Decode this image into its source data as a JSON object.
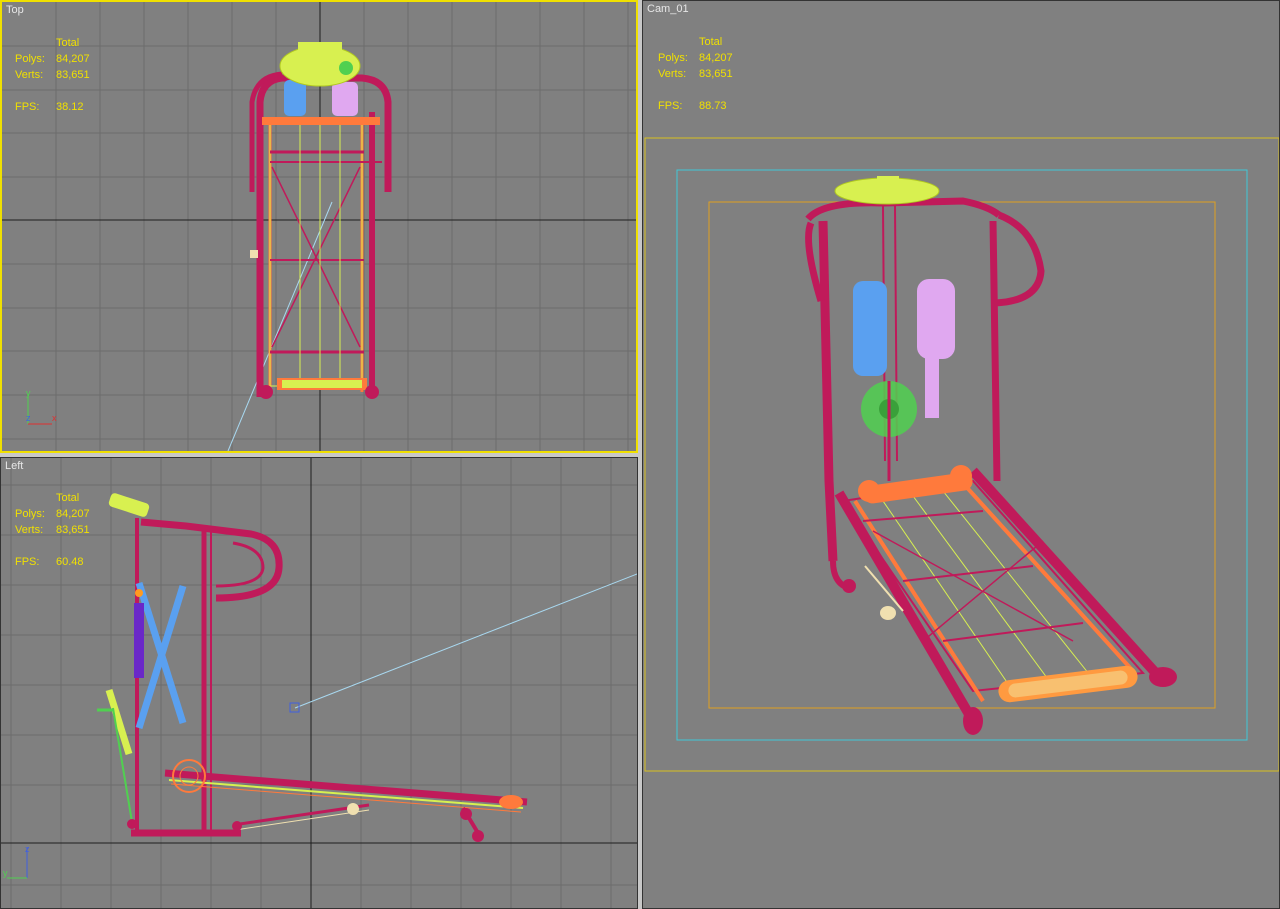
{
  "viewports": {
    "top": {
      "label": "Top",
      "stats": {
        "header": "Total",
        "polys_label": "Polys:",
        "polys": "84,207",
        "verts_label": "Verts:",
        "verts": "83,651",
        "fps_label": "FPS:",
        "fps": "38.12"
      },
      "axes": {
        "vertical": "y",
        "horizontal": "x",
        "center": "z"
      }
    },
    "left": {
      "label": "Left",
      "stats": {
        "header": "Total",
        "polys_label": "Polys:",
        "polys": "84,207",
        "verts_label": "Verts:",
        "verts": "83,651",
        "fps_label": "FPS:",
        "fps": "60.48"
      },
      "axes": {
        "vertical": "z",
        "horizontal": "y"
      }
    },
    "cam": {
      "label": "Cam_01",
      "stats": {
        "header": "Total",
        "polys_label": "Polys:",
        "polys": "84,207",
        "verts_label": "Verts:",
        "verts": "83,651",
        "fps_label": "FPS:",
        "fps": "88.73"
      }
    }
  },
  "colors": {
    "viewport_bg": "#808080",
    "grid": "#6c6c6c",
    "grid_axis": "#1e1e1e",
    "active_border": "#f0e000",
    "stats_text": "#f0e000",
    "frame": "#c01a5a",
    "belt": "#ff7a3c",
    "console": "#d8f050",
    "handle_left": "#5aa0f0",
    "handle_right": "#e0a8f0",
    "flywheel": "#50d050",
    "camera_line": "#a8d8f0"
  }
}
